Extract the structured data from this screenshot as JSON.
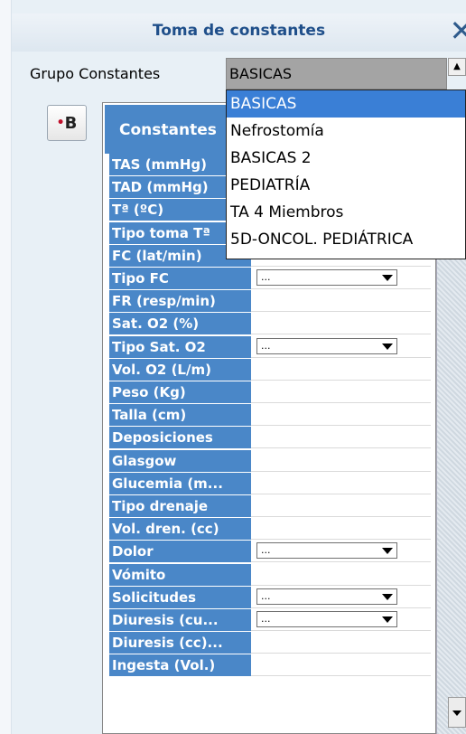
{
  "window": {
    "title": "Toma de constantes"
  },
  "group": {
    "label": "Grupo Constantes",
    "selected": "BASICAS",
    "options": [
      "BASICAS",
      "Nefrostomía",
      "BASICAS 2",
      "PEDIATRÍA",
      "TA 4 Miembros",
      "5D-ONCOL. PEDIÁTRICA"
    ]
  },
  "b_button": {
    "label": "B"
  },
  "table": {
    "header": "Constantes",
    "rows": [
      {
        "label": "TAS (mmHg)",
        "select": null
      },
      {
        "label": "TAD (mmHg)",
        "select": null
      },
      {
        "label": "Tª (ºC)",
        "select": null
      },
      {
        "label": "Tipo toma Tª",
        "select": null
      },
      {
        "label": "FC (lat/min)",
        "select": null
      },
      {
        "label": "Tipo FC",
        "select": "..."
      },
      {
        "label": "FR (resp/min)",
        "select": null
      },
      {
        "label": "Sat. O2 (%)",
        "select": null
      },
      {
        "label": "Tipo Sat. O2",
        "select": "..."
      },
      {
        "label": "Vol. O2 (L/m)",
        "select": null
      },
      {
        "label": "Peso (Kg)",
        "select": null
      },
      {
        "label": "Talla (cm)",
        "select": null
      },
      {
        "label": "Deposiciones",
        "select": null
      },
      {
        "label": "Glasgow",
        "select": null
      },
      {
        "label": "Glucemia (m...",
        "select": null
      },
      {
        "label": "Tipo drenaje",
        "select": null
      },
      {
        "label": "Vol. dren. (cc)",
        "select": null
      },
      {
        "label": "Dolor",
        "select": "..."
      },
      {
        "label": "Vómito",
        "select": null
      },
      {
        "label": "Solicitudes",
        "select": "..."
      },
      {
        "label": "Diuresis (cu...",
        "select": "..."
      },
      {
        "label": "Diuresis (cc)...",
        "select": null
      },
      {
        "label": "Ingesta (Vol.)",
        "select": null
      }
    ]
  },
  "icons": {
    "close": "close-icon",
    "scroll_up": "arrow-up-icon",
    "scroll_down": "arrow-down-icon",
    "dropdown_arrow": "chevron-down-icon"
  },
  "colors": {
    "header_blue": "#4a87c8",
    "title_blue": "#1f4f8a",
    "selection_blue": "#3a7fd6"
  }
}
